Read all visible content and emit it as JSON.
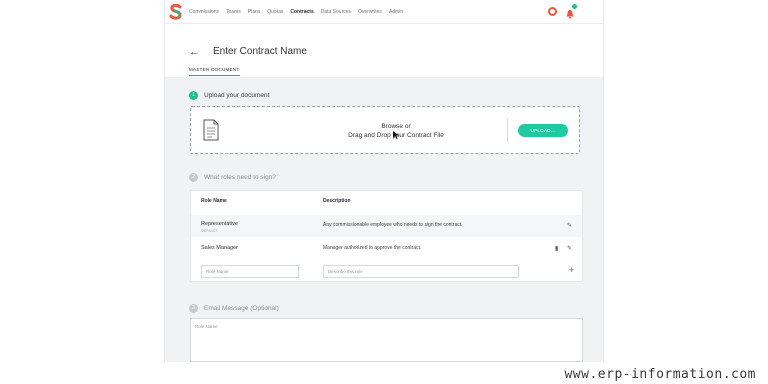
{
  "nav": {
    "items": [
      "Commissions",
      "Teams",
      "Plans",
      "Quotas",
      "Contracts",
      "Data Sources",
      "Overwrites",
      "Admin"
    ],
    "active_index": 4
  },
  "page": {
    "back_icon": "arrow-left-icon",
    "title": "Enter Contract Name",
    "tab": "MASTER DOCUMENT"
  },
  "step1": {
    "number": "1",
    "label": "Upload your document",
    "browse_line1": "Browse or",
    "browse_line2": "Drag and Drop your Contract File",
    "upload_button": "UPLOAD..."
  },
  "step2": {
    "number": "2",
    "label": "What roles need to sign?",
    "columns": [
      "Role Name",
      "Description"
    ],
    "rows": [
      {
        "name": "Representative",
        "sub": "DEFAULT",
        "description": "Any commissionable employee who needs to sign the contract."
      },
      {
        "name": "Sales Manager",
        "sub": "",
        "description": "Manager authorized to approve the contract."
      }
    ],
    "role_placeholder": "Role Name",
    "desc_placeholder": "Describe this role"
  },
  "step3": {
    "number": "3",
    "label": "Email Message (Optional)",
    "placeholder": "Role Name"
  },
  "watermark": "www.erp-information.com",
  "colors": {
    "accent": "#1fcaa0",
    "brand": "#e9573f",
    "tab_underline": "#e9573f"
  }
}
